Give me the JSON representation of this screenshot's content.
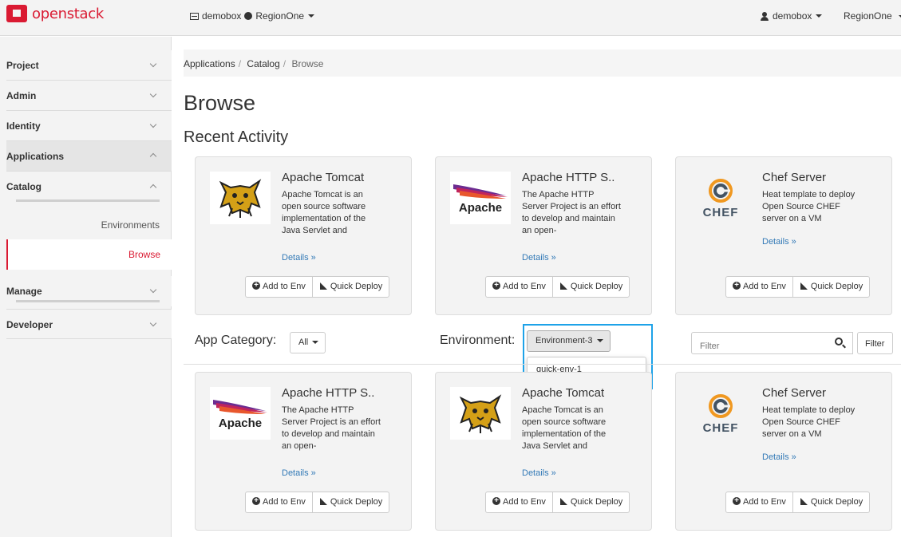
{
  "header": {
    "brand": "openstack",
    "context": {
      "project": "demobox",
      "region": "RegionOne"
    },
    "user": "demobox",
    "region": "RegionOne"
  },
  "sidebar": {
    "sections": [
      {
        "label": "Project",
        "expanded": false
      },
      {
        "label": "Admin",
        "expanded": false
      },
      {
        "label": "Identity",
        "expanded": false
      },
      {
        "label": "Applications",
        "expanded": true
      },
      {
        "label": "Manage",
        "expanded": false
      },
      {
        "label": "Developer",
        "expanded": false
      }
    ],
    "catalog": {
      "label": "Catalog",
      "items": [
        "Environments",
        "Browse"
      ],
      "active": "Browse"
    }
  },
  "breadcrumb": [
    "Applications",
    "Catalog",
    "Browse"
  ],
  "page_title": "Browse",
  "recent_activity_title": "Recent Activity",
  "card_actions": {
    "add": "Add to Env",
    "deploy": "Quick Deploy",
    "details": "Details »"
  },
  "recent_cards": [
    {
      "title": "Apache Tomcat",
      "desc": "Apache Tomcat is an open source software implementation of the Java Servlet and",
      "logo": "tomcat-logo"
    },
    {
      "title": "Apache HTTP S..",
      "desc": "The Apache HTTP Server Project is an effort to develop and maintain an open-",
      "logo": "apache-logo"
    },
    {
      "title": "Chef Server",
      "desc": "Heat template to deploy Open Source CHEF server on a VM",
      "logo": "chef-logo"
    }
  ],
  "filters": {
    "app_category_label": "App Category:",
    "app_category_value": "All",
    "environment_label": "Environment:",
    "environment_value": "Environment-3",
    "environment_options": [
      "quick-env-1"
    ],
    "filter_placeholder": "Filter",
    "filter_button": "Filter"
  },
  "catalog_cards": [
    {
      "title": "Apache HTTP S..",
      "desc": "The Apache HTTP Server Project is an effort to develop and maintain an open-",
      "logo": "apache-logo"
    },
    {
      "title": "Apache Tomcat",
      "desc": "Apache Tomcat is an open source software implementation of the Java Servlet and",
      "logo": "tomcat-logo"
    },
    {
      "title": "Chef Server",
      "desc": "Heat template to deploy Open Source CHEF server on a VM",
      "logo": "chef-logo"
    }
  ],
  "colors": {
    "brand": "#da1a32",
    "link": "#337ab7",
    "highlight": "#1ea2e8"
  }
}
